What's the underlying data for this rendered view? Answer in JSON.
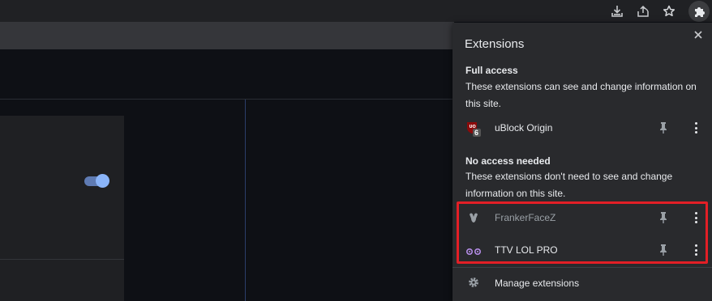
{
  "popup": {
    "title": "Extensions",
    "full_access": {
      "heading": "Full access",
      "description": "These extensions can see and change information on this site.",
      "items": [
        {
          "name": "uBlock Origin",
          "badge": "6",
          "icon": "ublock-origin-icon"
        }
      ]
    },
    "no_access": {
      "heading": "No access needed",
      "description": "These extensions don't need to see and change information on this site.",
      "items": [
        {
          "name": "FrankerFaceZ",
          "icon": "frankerfacez-icon"
        },
        {
          "name": "TTV LOL PRO",
          "icon": "ttv-lol-pro-icon"
        }
      ]
    },
    "manage_label": "Manage extensions"
  },
  "toolbar": {
    "icons": [
      "download-icon",
      "share-icon",
      "bookmark-star-icon",
      "extensions-puzzle-icon"
    ]
  },
  "colors": {
    "highlight": "#e21f26",
    "toggle_accent": "#8ab4f8"
  }
}
